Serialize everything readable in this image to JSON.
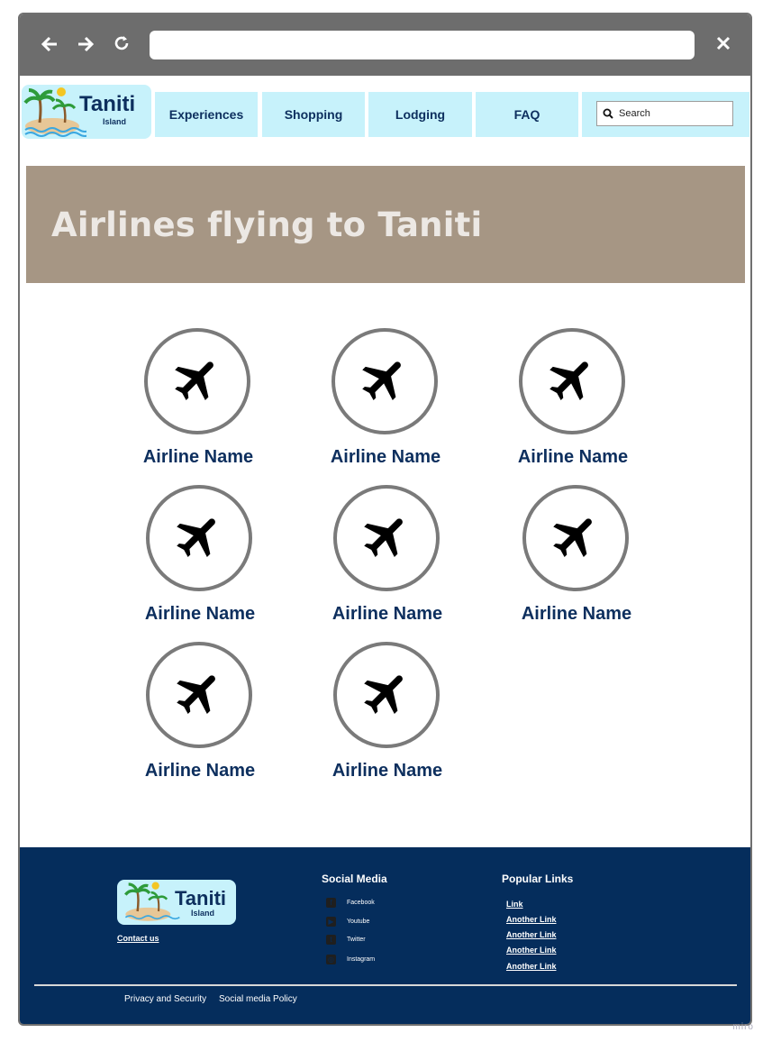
{
  "browser": {
    "back_icon": "arrow-left-icon",
    "forward_icon": "arrow-right-icon",
    "reload_icon": "reload-icon",
    "close_icon": "close-icon"
  },
  "logo": {
    "name": "Taniti",
    "sub": "Island"
  },
  "nav": {
    "items": [
      "Experiences",
      "Shopping",
      "Lodging",
      "FAQ"
    ],
    "search_placeholder": "Search"
  },
  "hero": {
    "title": "Airlines flying to Taniti"
  },
  "airlines": [
    "Airline Name",
    "Airline Name",
    "Airline Name",
    "Airline Name",
    "Airline Name",
    "Airline Name",
    "Airline Name",
    "Airline Name"
  ],
  "footer": {
    "logo_name": "Taniti",
    "logo_sub": "Island",
    "contact": "Contact us",
    "social_heading": "Social Media",
    "social": [
      "Facebook",
      "Youtube",
      "Twitter",
      "Instagram"
    ],
    "popular_heading": "Popular Links",
    "links": [
      "Link",
      "Another Link",
      "Another Link",
      "Another Link",
      "Another Link"
    ],
    "privacy": "Privacy and Security",
    "policy": "Social media Policy"
  },
  "watermark": "miro",
  "colors": {
    "nav_bg": "#c7f2fb",
    "hero_bg": "#a69684",
    "footer_bg": "#052d5c",
    "text_dark": "#0d2f5e"
  }
}
